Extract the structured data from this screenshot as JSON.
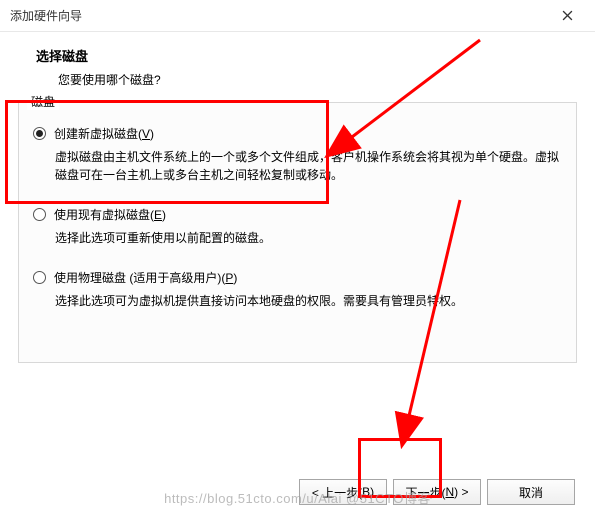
{
  "window": {
    "title": "添加硬件向导"
  },
  "header": {
    "title": "选择磁盘",
    "subtitle": "您要使用哪个磁盘?"
  },
  "group": {
    "label": "磁盘"
  },
  "options": [
    {
      "label_pre": "创建新虚拟磁盘(",
      "mnemonic": "V",
      "label_post": ")",
      "desc": "虚拟磁盘由主机文件系统上的一个或多个文件组成，客户机操作系统会将其视为单个硬盘。虚拟磁盘可在一台主机上或多台主机之间轻松复制或移动。",
      "checked": true
    },
    {
      "label_pre": "使用现有虚拟磁盘(",
      "mnemonic": "E",
      "label_post": ")",
      "desc": "选择此选项可重新使用以前配置的磁盘。",
      "checked": false
    },
    {
      "label_pre": "使用物理磁盘 (适用于高级用户)(",
      "mnemonic": "P",
      "label_post": ")",
      "desc": "选择此选项可为虚拟机提供直接访问本地硬盘的权限。需要具有管理员特权。",
      "checked": false
    }
  ],
  "buttons": {
    "back_pre": "< 上一步(",
    "back_mn": "B",
    "back_post": ")",
    "next_pre": "下一步(",
    "next_mn": "N",
    "next_post": ") >",
    "cancel": "取消"
  },
  "watermark": "https://blog.51cto.com/u/Alai @51CTO博客"
}
